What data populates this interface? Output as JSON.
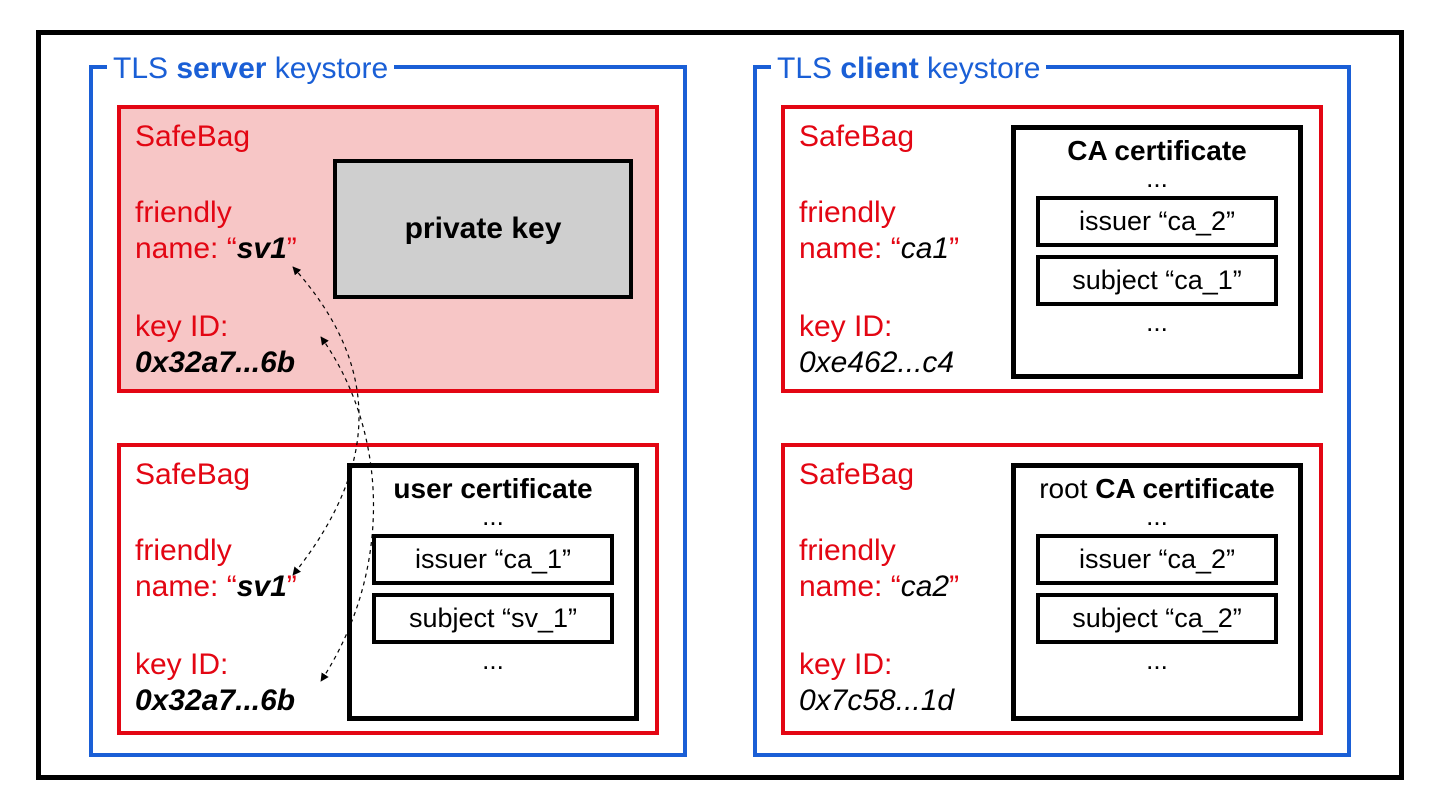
{
  "server_keystore": {
    "title_prefix": "TLS ",
    "title_bold": "server",
    "title_suffix": " keystore",
    "bag1": {
      "label": "SafeBag",
      "friendly_label": "friendly",
      "name_label_prefix": "name: “",
      "name_label_suffix": "”",
      "friendly_value": "sv1",
      "keyid_label": "key ID:",
      "keyid_value": "0x32a7...6b",
      "privkey_label": "private key"
    },
    "bag2": {
      "label": "SafeBag",
      "friendly_label": "friendly",
      "name_label_prefix": "name: “",
      "name_label_suffix": "”",
      "friendly_value": "sv1",
      "keyid_label": "key ID:",
      "keyid_value": "0x32a7...6b",
      "cert_title": "user certificate",
      "issuer": "issuer “ca_1”",
      "subject": "subject “sv_1”"
    }
  },
  "client_keystore": {
    "title_prefix": "TLS ",
    "title_bold": "client",
    "title_suffix": " keystore",
    "bag1": {
      "label": "SafeBag",
      "friendly_label": "friendly",
      "name_label_prefix": "name: “",
      "name_label_suffix": "”",
      "friendly_value": "ca1",
      "keyid_label": "key ID:",
      "keyid_value": "0xe462...c4",
      "cert_title": "CA certificate",
      "issuer": "issuer “ca_2”",
      "subject": "subject “ca_1”"
    },
    "bag2": {
      "label": "SafeBag",
      "friendly_label": "friendly",
      "name_label_prefix": "name: “",
      "name_label_suffix": "”",
      "friendly_value": "ca2",
      "keyid_label": "key ID:",
      "keyid_value": "0x7c58...1d",
      "cert_title_lite": "root ",
      "cert_title_bold": "CA certificate",
      "issuer": "issuer “ca_2”",
      "subject": "subject “ca_2”"
    }
  },
  "dots": "..."
}
